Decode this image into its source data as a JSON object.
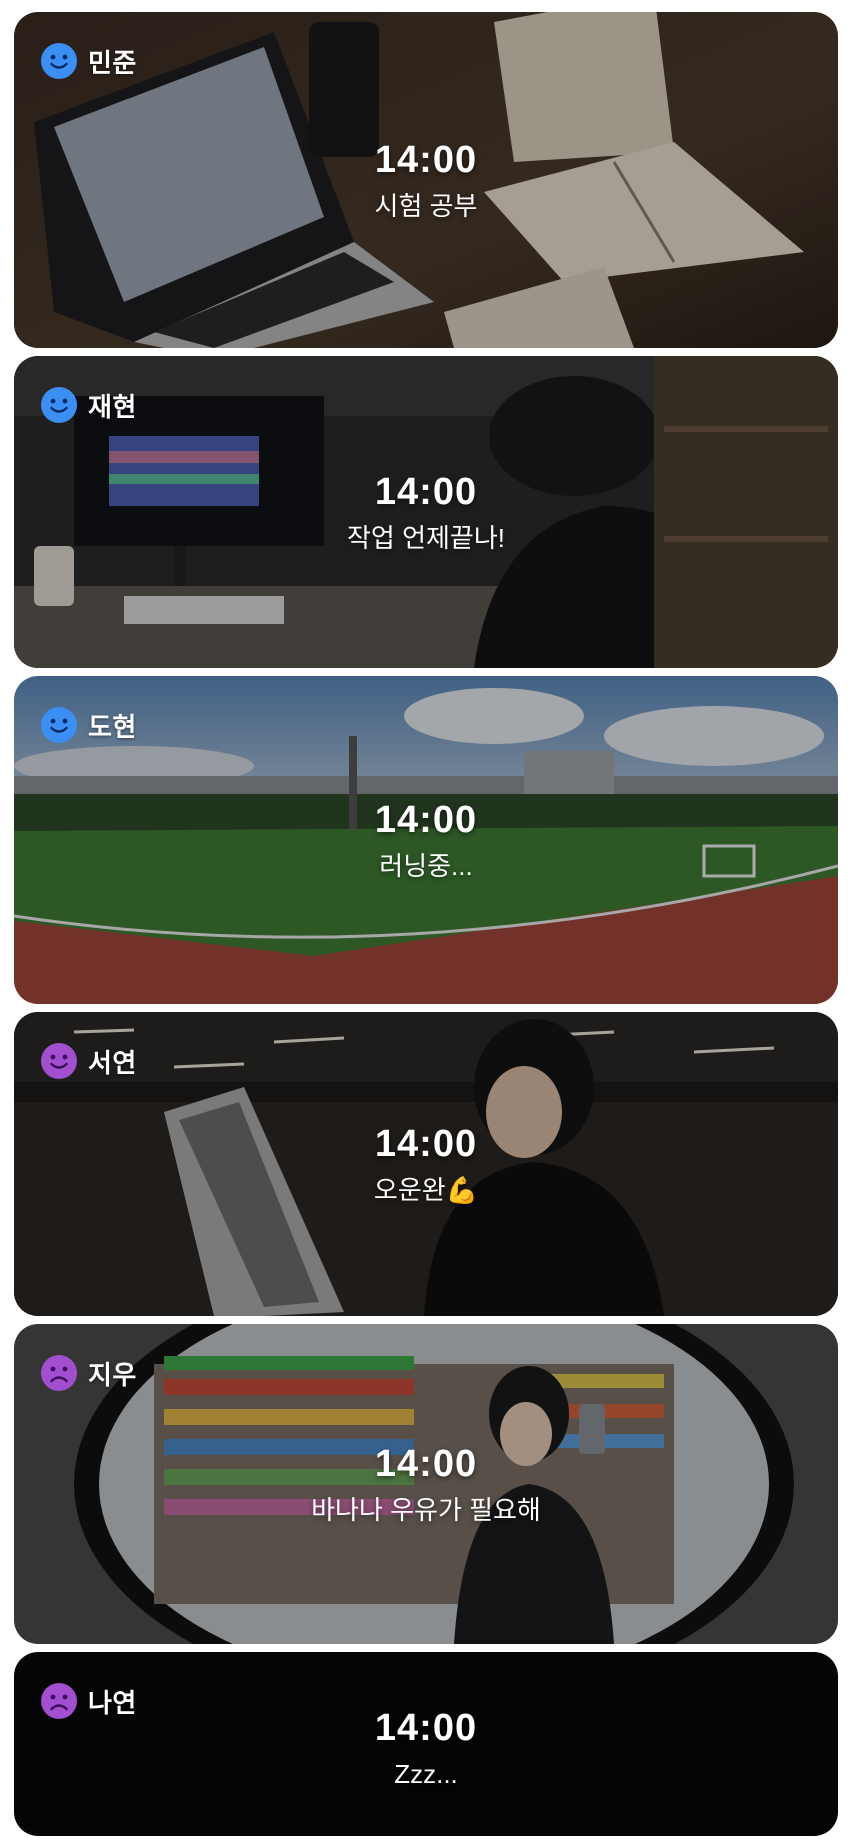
{
  "feed": {
    "cards": [
      {
        "name": "민준",
        "mood_icon": "smile-face-icon",
        "mood_color": "#3b8ff3",
        "time": "14:00",
        "status": "시험 공부",
        "scene": "laptop-study-desk-photo"
      },
      {
        "name": "재현",
        "mood_icon": "smile-face-icon",
        "mood_color": "#3b8ff3",
        "time": "14:00",
        "status": "작업 언제끝나!",
        "scene": "computer-desk-work-photo"
      },
      {
        "name": "도현",
        "mood_icon": "smile-face-icon",
        "mood_color": "#3b8ff3",
        "time": "14:00",
        "status": "러닝중...",
        "scene": "running-track-field-photo"
      },
      {
        "name": "서연",
        "mood_icon": "smile-face-icon",
        "mood_color": "#a14fd0",
        "time": "14:00",
        "status": "오운완💪",
        "scene": "gym-treadmill-photo"
      },
      {
        "name": "지우",
        "mood_icon": "sad-face-icon",
        "mood_color": "#a14fd0",
        "time": "14:00",
        "status": "바나나 우유가 필요해",
        "scene": "convenience-store-mirror-photo"
      },
      {
        "name": "나연",
        "mood_icon": "sad-face-icon",
        "mood_color": "#a14fd0",
        "time": "14:00",
        "status": "Zzz...",
        "scene": "dark-sleeping"
      }
    ]
  }
}
